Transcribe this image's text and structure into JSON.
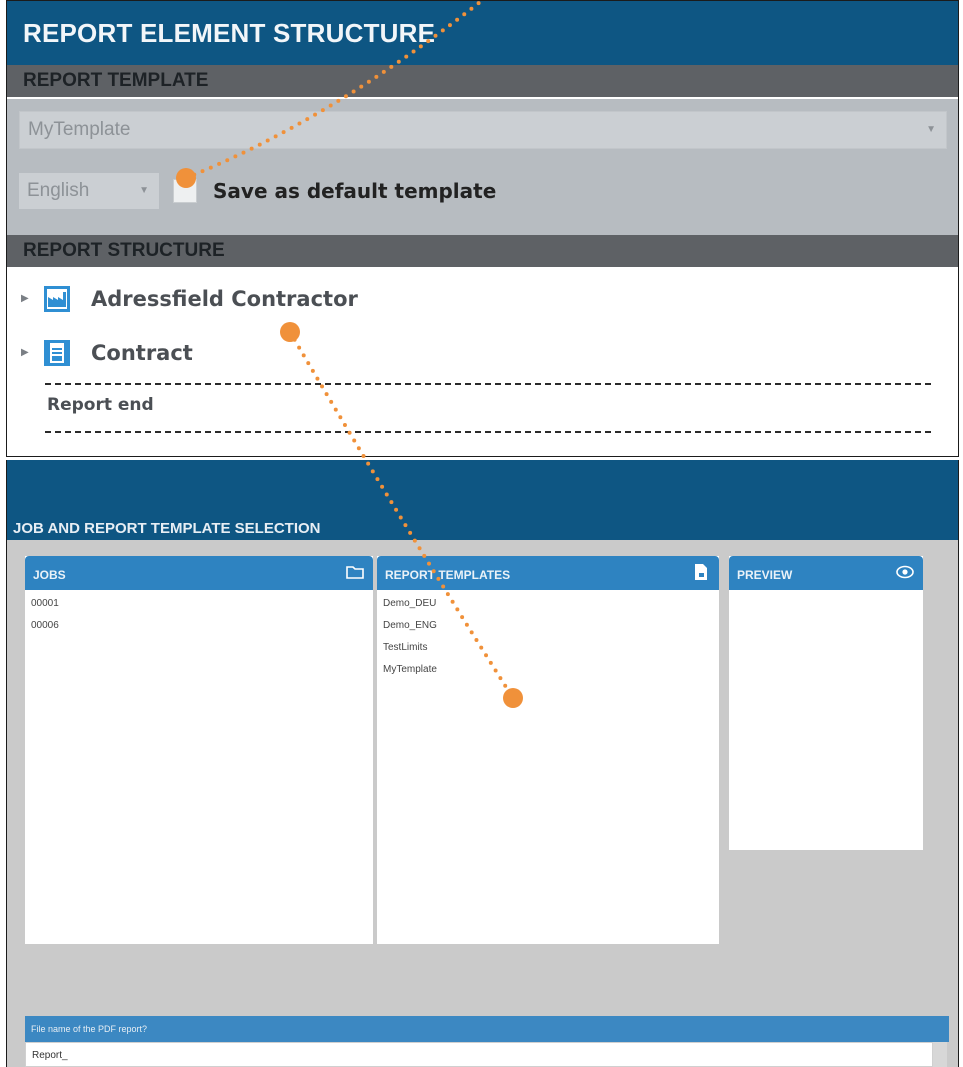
{
  "top_panel": {
    "title": "REPORT ELEMENT STRUCTURE",
    "template_section": {
      "header": "REPORT TEMPLATE",
      "template_value": "MyTemplate",
      "language_value": "English",
      "save_default_label": "Save as default template",
      "save_default_checked": false
    },
    "structure_section": {
      "header": "REPORT STRUCTURE",
      "items": [
        {
          "label": "Adressfield Contractor",
          "icon": "factory-icon"
        },
        {
          "label": "Contract",
          "icon": "document-icon"
        }
      ],
      "end_label": "Report end"
    }
  },
  "bottom_panel": {
    "title": "JOB AND REPORT TEMPLATE SELECTION",
    "jobs": {
      "header": "JOBS",
      "icon": "folder-icon",
      "items": [
        "00001",
        "00006"
      ]
    },
    "templates": {
      "header": "REPORT TEMPLATES",
      "icon": "file-icon",
      "items": [
        "Demo_DEU",
        "Demo_ENG",
        "TestLimits",
        "MyTemplate"
      ]
    },
    "preview": {
      "header": "PREVIEW",
      "icon": "eye-icon"
    },
    "filename": {
      "label": "File name of the PDF report?",
      "value": "Report_"
    }
  },
  "colors": {
    "header_blue": "#0e5683",
    "column_blue": "#2e83c1",
    "section_gray": "#5e6165",
    "annotation_orange": "#f0913a"
  }
}
